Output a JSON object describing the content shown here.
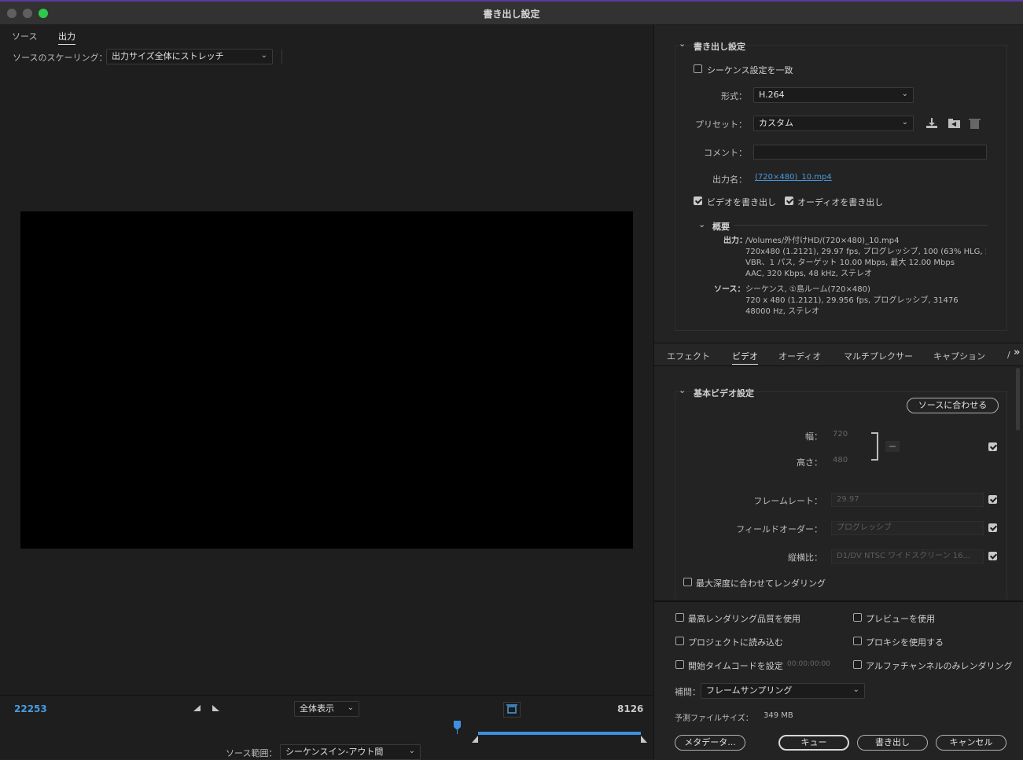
{
  "window": {
    "title": "書き出し設定"
  },
  "left": {
    "tabs": [
      "ソース",
      "出力"
    ],
    "scaling_label": "ソースのスケーリング：",
    "scaling_value": "出力サイズ全体にストレッチ",
    "timecode_left": "22253",
    "zoom_value": "全体表示",
    "timecode_right": "8126",
    "source_range_label": "ソース範囲：",
    "source_range_value": "シーケンスイン-アウト間"
  },
  "export": {
    "section_title": "書き出し設定",
    "match_sequence": "シーケンス設定を一致",
    "format_label": "形式：",
    "format_value": "H.264",
    "preset_label": "プリセット：",
    "preset_value": "カスタム",
    "comment_label": "コメント：",
    "comment_value": "",
    "output_name_label": "出力名：",
    "output_name_value": "(720×480)_10.mp4",
    "export_video": "ビデオを書き出し",
    "export_audio": "オーディオを書き出し",
    "summary_title": "概要",
    "output_label": "出力：",
    "output_lines": [
      "/Volumes/外付けHD/(720×480)_10.mp4",
      "720x480 (1.2121), 29.97 fps, プログレッシブ, 100 (63% HLG, 51%...",
      "VBR、1 パス, ターゲット 10.00 Mbps, 最大 12.00 Mbps",
      "AAC, 320 Kbps, 48 kHz, ステレオ"
    ],
    "source_label": "ソース：",
    "source_lines": [
      "シーケンス, ①島ルーム(720×480)",
      "720 x 480 (1.2121), 29.956 fps, プログレッシブ, 31476",
      "48000 Hz, ステレオ"
    ]
  },
  "tabs": [
    "エフェクト",
    "ビデオ",
    "オーディオ",
    "マルチプレクサー",
    "キャプション",
    "/"
  ],
  "video": {
    "section_title": "基本ビデオ設定",
    "match_source": "ソースに合わせる",
    "width_label": "幅：",
    "width_value": "720",
    "height_label": "高さ：",
    "height_value": "480",
    "framerate_label": "フレームレート：",
    "framerate_value": "29.97",
    "field_order_label": "フィールドオーダー：",
    "field_order_value": "プログレッシブ",
    "aspect_label": "縦横比：",
    "aspect_value": "D1/DV NTSC ワイドスクリーン 16...",
    "max_depth": "最大深度に合わせてレンダリング"
  },
  "bottom": {
    "max_quality": "最高レンダリング品質を使用",
    "use_preview": "プレビューを使用",
    "import_project": "プロジェクトに読み込む",
    "use_proxy": "プロキシを使用する",
    "start_timecode": "開始タイムコードを設定",
    "start_timecode_value": "00:00:00:00",
    "alpha_only": "アルファチャンネルのみレンダリング",
    "interp_label": "補間：",
    "interp_value": "フレームサンプリング",
    "est_size_label": "予測ファイルサイズ：",
    "est_size_value": "349 MB",
    "buttons": [
      "メタデータ...",
      "キュー",
      "書き出し",
      "キャンセル"
    ]
  },
  "colors": {
    "accent": "#4a9be0",
    "close": "#5f5f5f",
    "min": "#5f5f5f",
    "max": "#2ec84a",
    "playhead": "#3f8fe0"
  }
}
